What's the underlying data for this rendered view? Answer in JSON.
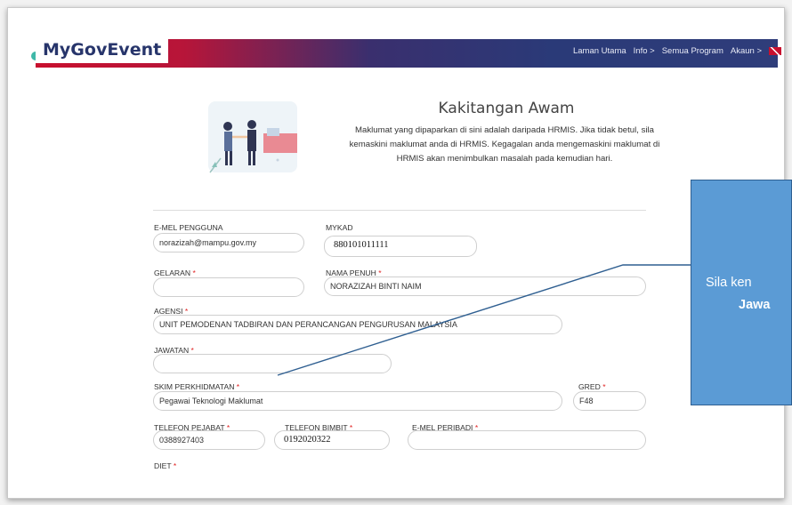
{
  "header": {
    "brand": "MyGovEvent",
    "nav": [
      "Laman Utama",
      "Info >",
      "Semua Program",
      "Akaun >"
    ]
  },
  "profile": {
    "heading": "Kakitangan Awam",
    "intro": "Maklumat yang dipaparkan di sini adalah daripada HRMIS. Jika tidak betul, sila kemaskini maklumat anda di HRMIS. Kegagalan anda mengemaskini maklumat di HRMIS akan menimbulkan masalah pada kemudian hari."
  },
  "form": {
    "email_label": "E-MEL PENGGUNA",
    "email_value": "norazizah@mampu.gov.my",
    "mykad_label": "MYKAD",
    "mykad_value": "880101011111",
    "gelaran_label": "GELARAN",
    "gelaran_value": "",
    "nama_label": "NAMA PENUH",
    "nama_value": "NORAZIZAH BINTI NAIM",
    "agensi_label": "AGENSI",
    "agensi_value": "UNIT PEMODENAN TADBIRAN DAN PERANCANGAN PENGURUSAN MALAYSIA",
    "jawatan_label": "JAWATAN",
    "jawatan_value": "",
    "skim_label": "SKIM PERKHIDMATAN",
    "skim_value": "Pegawai Teknologi Maklumat",
    "gred_label": "GRED",
    "gred_value": "F48",
    "tel_pejabat_label": "TELEFON PEJABAT",
    "tel_pejabat_value": "0388927403",
    "tel_bimbit_label": "TELEFON BIMBIT",
    "tel_bimbit_value": "0192020322",
    "emel_peribadi_label": "E-MEL PERIBADI",
    "emel_peribadi_value": "",
    "diet_label": "DIET",
    "required_mark": "*"
  },
  "callout": {
    "line1": "Sila ken",
    "line2": "Jawa"
  },
  "colors": {
    "callout_bg": "#5b9bd5",
    "required": "#e02020",
    "brand": "#27356b"
  }
}
